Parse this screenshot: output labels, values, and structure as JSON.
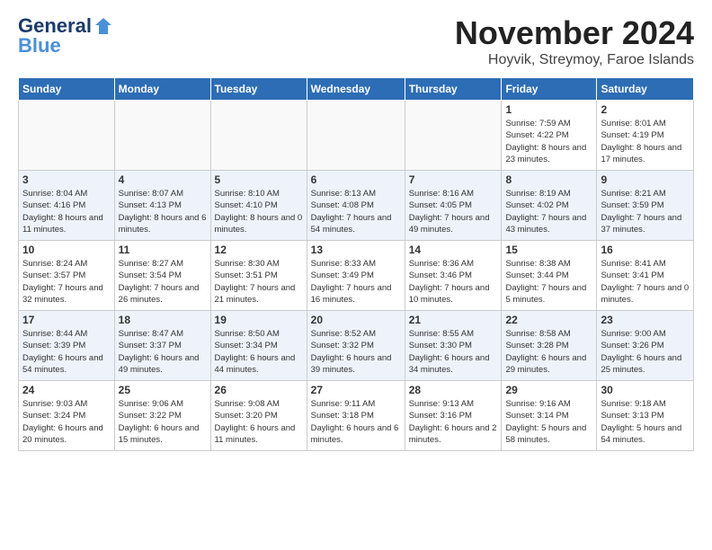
{
  "header": {
    "logo_general": "General",
    "logo_blue": "Blue",
    "month": "November 2024",
    "location": "Hoyvik, Streymoy, Faroe Islands"
  },
  "weekdays": [
    "Sunday",
    "Monday",
    "Tuesday",
    "Wednesday",
    "Thursday",
    "Friday",
    "Saturday"
  ],
  "weeks": [
    [
      {
        "day": "",
        "sunrise": "",
        "sunset": "",
        "daylight": ""
      },
      {
        "day": "",
        "sunrise": "",
        "sunset": "",
        "daylight": ""
      },
      {
        "day": "",
        "sunrise": "",
        "sunset": "",
        "daylight": ""
      },
      {
        "day": "",
        "sunrise": "",
        "sunset": "",
        "daylight": ""
      },
      {
        "day": "",
        "sunrise": "",
        "sunset": "",
        "daylight": ""
      },
      {
        "day": "1",
        "sunrise": "Sunrise: 7:59 AM",
        "sunset": "Sunset: 4:22 PM",
        "daylight": "Daylight: 8 hours and 23 minutes."
      },
      {
        "day": "2",
        "sunrise": "Sunrise: 8:01 AM",
        "sunset": "Sunset: 4:19 PM",
        "daylight": "Daylight: 8 hours and 17 minutes."
      }
    ],
    [
      {
        "day": "3",
        "sunrise": "Sunrise: 8:04 AM",
        "sunset": "Sunset: 4:16 PM",
        "daylight": "Daylight: 8 hours and 11 minutes."
      },
      {
        "day": "4",
        "sunrise": "Sunrise: 8:07 AM",
        "sunset": "Sunset: 4:13 PM",
        "daylight": "Daylight: 8 hours and 6 minutes."
      },
      {
        "day": "5",
        "sunrise": "Sunrise: 8:10 AM",
        "sunset": "Sunset: 4:10 PM",
        "daylight": "Daylight: 8 hours and 0 minutes."
      },
      {
        "day": "6",
        "sunrise": "Sunrise: 8:13 AM",
        "sunset": "Sunset: 4:08 PM",
        "daylight": "Daylight: 7 hours and 54 minutes."
      },
      {
        "day": "7",
        "sunrise": "Sunrise: 8:16 AM",
        "sunset": "Sunset: 4:05 PM",
        "daylight": "Daylight: 7 hours and 49 minutes."
      },
      {
        "day": "8",
        "sunrise": "Sunrise: 8:19 AM",
        "sunset": "Sunset: 4:02 PM",
        "daylight": "Daylight: 7 hours and 43 minutes."
      },
      {
        "day": "9",
        "sunrise": "Sunrise: 8:21 AM",
        "sunset": "Sunset: 3:59 PM",
        "daylight": "Daylight: 7 hours and 37 minutes."
      }
    ],
    [
      {
        "day": "10",
        "sunrise": "Sunrise: 8:24 AM",
        "sunset": "Sunset: 3:57 PM",
        "daylight": "Daylight: 7 hours and 32 minutes."
      },
      {
        "day": "11",
        "sunrise": "Sunrise: 8:27 AM",
        "sunset": "Sunset: 3:54 PM",
        "daylight": "Daylight: 7 hours and 26 minutes."
      },
      {
        "day": "12",
        "sunrise": "Sunrise: 8:30 AM",
        "sunset": "Sunset: 3:51 PM",
        "daylight": "Daylight: 7 hours and 21 minutes."
      },
      {
        "day": "13",
        "sunrise": "Sunrise: 8:33 AM",
        "sunset": "Sunset: 3:49 PM",
        "daylight": "Daylight: 7 hours and 16 minutes."
      },
      {
        "day": "14",
        "sunrise": "Sunrise: 8:36 AM",
        "sunset": "Sunset: 3:46 PM",
        "daylight": "Daylight: 7 hours and 10 minutes."
      },
      {
        "day": "15",
        "sunrise": "Sunrise: 8:38 AM",
        "sunset": "Sunset: 3:44 PM",
        "daylight": "Daylight: 7 hours and 5 minutes."
      },
      {
        "day": "16",
        "sunrise": "Sunrise: 8:41 AM",
        "sunset": "Sunset: 3:41 PM",
        "daylight": "Daylight: 7 hours and 0 minutes."
      }
    ],
    [
      {
        "day": "17",
        "sunrise": "Sunrise: 8:44 AM",
        "sunset": "Sunset: 3:39 PM",
        "daylight": "Daylight: 6 hours and 54 minutes."
      },
      {
        "day": "18",
        "sunrise": "Sunrise: 8:47 AM",
        "sunset": "Sunset: 3:37 PM",
        "daylight": "Daylight: 6 hours and 49 minutes."
      },
      {
        "day": "19",
        "sunrise": "Sunrise: 8:50 AM",
        "sunset": "Sunset: 3:34 PM",
        "daylight": "Daylight: 6 hours and 44 minutes."
      },
      {
        "day": "20",
        "sunrise": "Sunrise: 8:52 AM",
        "sunset": "Sunset: 3:32 PM",
        "daylight": "Daylight: 6 hours and 39 minutes."
      },
      {
        "day": "21",
        "sunrise": "Sunrise: 8:55 AM",
        "sunset": "Sunset: 3:30 PM",
        "daylight": "Daylight: 6 hours and 34 minutes."
      },
      {
        "day": "22",
        "sunrise": "Sunrise: 8:58 AM",
        "sunset": "Sunset: 3:28 PM",
        "daylight": "Daylight: 6 hours and 29 minutes."
      },
      {
        "day": "23",
        "sunrise": "Sunrise: 9:00 AM",
        "sunset": "Sunset: 3:26 PM",
        "daylight": "Daylight: 6 hours and 25 minutes."
      }
    ],
    [
      {
        "day": "24",
        "sunrise": "Sunrise: 9:03 AM",
        "sunset": "Sunset: 3:24 PM",
        "daylight": "Daylight: 6 hours and 20 minutes."
      },
      {
        "day": "25",
        "sunrise": "Sunrise: 9:06 AM",
        "sunset": "Sunset: 3:22 PM",
        "daylight": "Daylight: 6 hours and 15 minutes."
      },
      {
        "day": "26",
        "sunrise": "Sunrise: 9:08 AM",
        "sunset": "Sunset: 3:20 PM",
        "daylight": "Daylight: 6 hours and 11 minutes."
      },
      {
        "day": "27",
        "sunrise": "Sunrise: 9:11 AM",
        "sunset": "Sunset: 3:18 PM",
        "daylight": "Daylight: 6 hours and 6 minutes."
      },
      {
        "day": "28",
        "sunrise": "Sunrise: 9:13 AM",
        "sunset": "Sunset: 3:16 PM",
        "daylight": "Daylight: 6 hours and 2 minutes."
      },
      {
        "day": "29",
        "sunrise": "Sunrise: 9:16 AM",
        "sunset": "Sunset: 3:14 PM",
        "daylight": "Daylight: 5 hours and 58 minutes."
      },
      {
        "day": "30",
        "sunrise": "Sunrise: 9:18 AM",
        "sunset": "Sunset: 3:13 PM",
        "daylight": "Daylight: 5 hours and 54 minutes."
      }
    ]
  ]
}
